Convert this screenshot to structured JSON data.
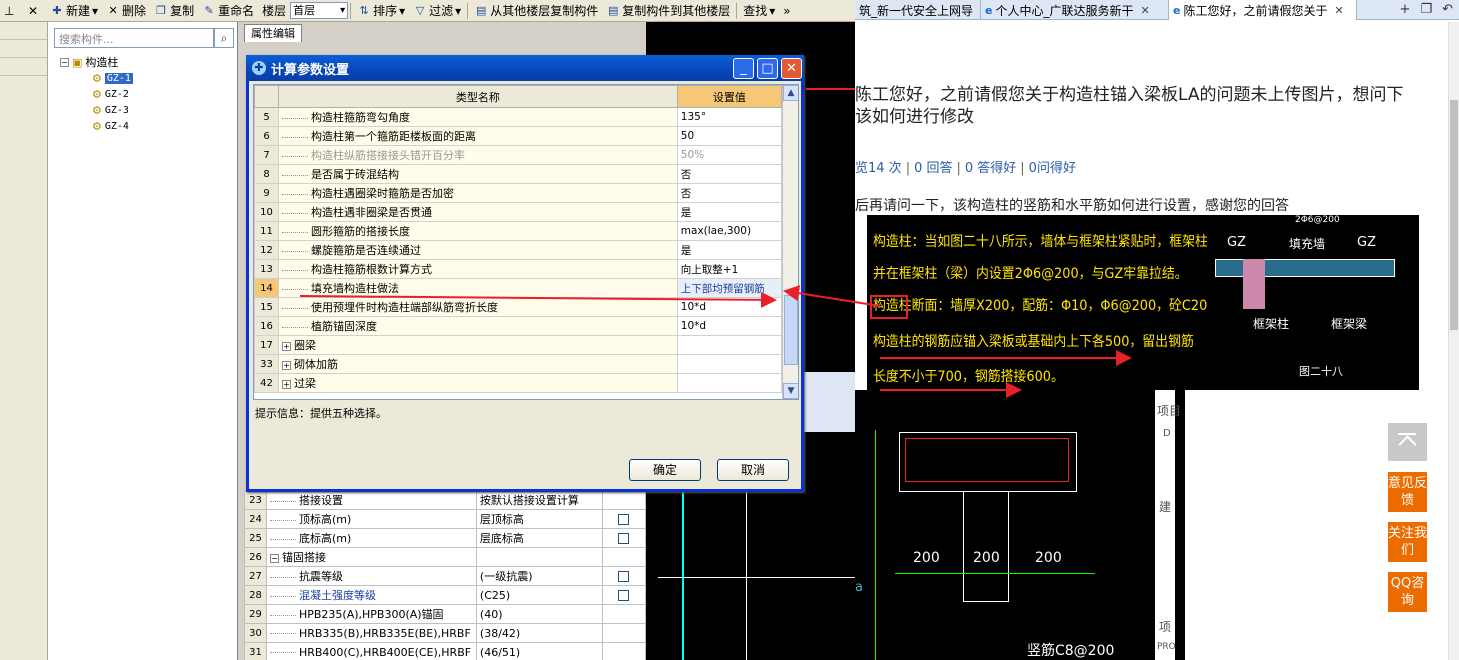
{
  "toolbar": {
    "new": "新建",
    "delete": "删除",
    "copy": "复制",
    "rename": "重命名",
    "floor_label": "楼层",
    "floor_value": "首层",
    "sort": "排序",
    "filter": "过滤",
    "copy_from_other": "从其他楼层复制构件",
    "copy_to_other": "复制构件到其他楼层",
    "find": "查找"
  },
  "tree_panel": {
    "search_placeholder": "搜索构件...",
    "root": "构造柱",
    "children": [
      "GZ-1",
      "GZ-2",
      "GZ-3",
      "GZ-4"
    ]
  },
  "prop_panel": {
    "tab": "属性编辑",
    "rows": [
      {
        "num": "23",
        "name": "搭接设置",
        "value": "按默认搭接设置计算",
        "type": "plain"
      },
      {
        "num": "24",
        "name": "顶标高(m)",
        "value": "层顶标高",
        "type": "check"
      },
      {
        "num": "25",
        "name": "底标高(m)",
        "value": "层底标高",
        "type": "check"
      },
      {
        "num": "26",
        "name": "锚固搭接",
        "value": "",
        "type": "group"
      },
      {
        "num": "27",
        "name": "抗震等级",
        "value": "(一级抗震)",
        "type": "check"
      },
      {
        "num": "28",
        "name": "混凝土强度等级",
        "value": "(C25)",
        "type": "checkblue"
      },
      {
        "num": "29",
        "name": "HPB235(A),HPB300(A)锚固",
        "value": "(40)",
        "type": "plain"
      },
      {
        "num": "30",
        "name": "HRB335(B),HRB335E(BE),HRBF",
        "value": "(38/42)",
        "type": "plain"
      },
      {
        "num": "31",
        "name": "HRB400(C),HRB400E(CE),HRBF",
        "value": "(46/51)",
        "type": "plain"
      }
    ]
  },
  "dialog": {
    "title": "计算参数设置",
    "col_name": "类型名称",
    "col_value": "设置值",
    "rows": [
      {
        "num": "5",
        "name": "构造柱箍筋弯勾角度",
        "value": "135°",
        "kind": "item"
      },
      {
        "num": "6",
        "name": "构造柱第一个箍筋距楼板面的距离",
        "value": "50",
        "kind": "item"
      },
      {
        "num": "7",
        "name": "构造柱纵筋搭接接头错开百分率",
        "value": "50%",
        "kind": "grey"
      },
      {
        "num": "8",
        "name": "是否属于砖混结构",
        "value": "否",
        "kind": "item"
      },
      {
        "num": "9",
        "name": "构造柱遇圈梁时箍筋是否加密",
        "value": "否",
        "kind": "item"
      },
      {
        "num": "10",
        "name": "构造柱遇非圈梁是否贯通",
        "value": "是",
        "kind": "item"
      },
      {
        "num": "11",
        "name": "圆形箍筋的搭接长度",
        "value": "max(lae,300)",
        "kind": "item"
      },
      {
        "num": "12",
        "name": "螺旋箍筋是否连续通过",
        "value": "是",
        "kind": "item"
      },
      {
        "num": "13",
        "name": "构造柱箍筋根数计算方式",
        "value": "向上取整+1",
        "kind": "item"
      },
      {
        "num": "14",
        "name": "填充墙构造柱做法",
        "value": "上下部均预留钢筋",
        "kind": "cur"
      },
      {
        "num": "15",
        "name": "使用预埋件时构造柱端部纵筋弯折长度",
        "value": "10*d",
        "kind": "item"
      },
      {
        "num": "16",
        "name": "植筋锚固深度",
        "value": "10*d",
        "kind": "item"
      },
      {
        "num": "17",
        "name": "圈梁",
        "value": "",
        "kind": "group"
      },
      {
        "num": "33",
        "name": "砌体加筋",
        "value": "",
        "kind": "group"
      },
      {
        "num": "42",
        "name": "过梁",
        "value": "",
        "kind": "group"
      }
    ],
    "hint": "提示信息：提供五种选择。",
    "ok": "确定",
    "cancel": "取消"
  },
  "browser": {
    "tabs": [
      {
        "title": "筑_新一代安全上网导",
        "active": false
      },
      {
        "title": "个人中心_广联达服务新干",
        "active": false
      },
      {
        "title": "陈工您好，之前请假您关于",
        "active": true
      }
    ],
    "question_title": "陈工您好，之前请假您关于构造柱锚入梁板LA的问题未上传图片，想问下该如何进行修改",
    "stats": [
      "览14 次",
      "0 回答",
      "0 答得好",
      "0问得好"
    ],
    "question_text": "后再请问一下，该构造柱的竖筋和水平筋如何进行设置，感谢您的回答",
    "cad_lines": [
      "构造柱：当如图二十八所示，墙体与框架柱紧贴时，框架柱位置应设GZ，",
      "并在框架柱（梁）内设置2Φ6@200，与GZ牢靠拉结。",
      "构造柱断面：墙厚X200，配筋：Φ10，Φ6@200，砼C20。",
      "构造柱的钢筋应锚入梁板或基础内上下各500，留出钢筋",
      "长度不小于700，钢筋搭接600。"
    ],
    "cad_labels": {
      "gz_left": "GZ",
      "fill_wall": "填充墙",
      "gz_right": "GZ",
      "frame_col": "框架柱",
      "frame_beam": "框架梁",
      "fig_no": "图二十八",
      "top_bar": "2Φ6@200"
    },
    "dims": [
      "200",
      "200",
      "200"
    ],
    "rebar_label": "竖筋C8@200",
    "side_letters": [
      "项目",
      "D",
      "建",
      "项",
      "PRO"
    ],
    "side_letter_a": "a",
    "floating": {
      "feedback": "意见反馈",
      "follow": "关注我们",
      "qq": "QQ咨询"
    }
  },
  "colors": {
    "accent_red": "#e8202a",
    "orange": "#ec6c00",
    "title_blue": "#0a5fd8"
  }
}
